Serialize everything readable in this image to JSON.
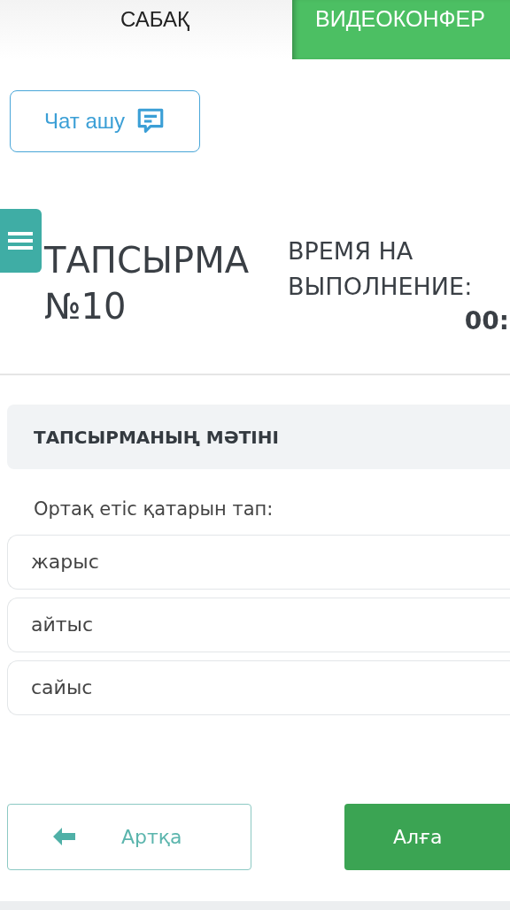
{
  "top_nav": [
    {
      "kind": "tab",
      "label": "САБАҚ"
    },
    {
      "kind": "button",
      "label": "ВИДЕОКОНФЕР"
    }
  ],
  "chat_button": {
    "label": "Чат ашу"
  },
  "task": {
    "title": "ТАПСЫРМА №10",
    "timer_label": "ВРЕМЯ НА ВЫПОЛНЕНИЕ:",
    "timer_value": "00:"
  },
  "section": {
    "heading": "ТАПСЫРМАНЫҢ МӘТІНІ",
    "question": "Ортақ етіс қатарын тап:"
  },
  "options": [
    {
      "label": "жарыс"
    },
    {
      "label": "айтыс"
    },
    {
      "label": "сайыс"
    }
  ],
  "navigation": {
    "back": "Артқа",
    "forward": "Алға"
  }
}
